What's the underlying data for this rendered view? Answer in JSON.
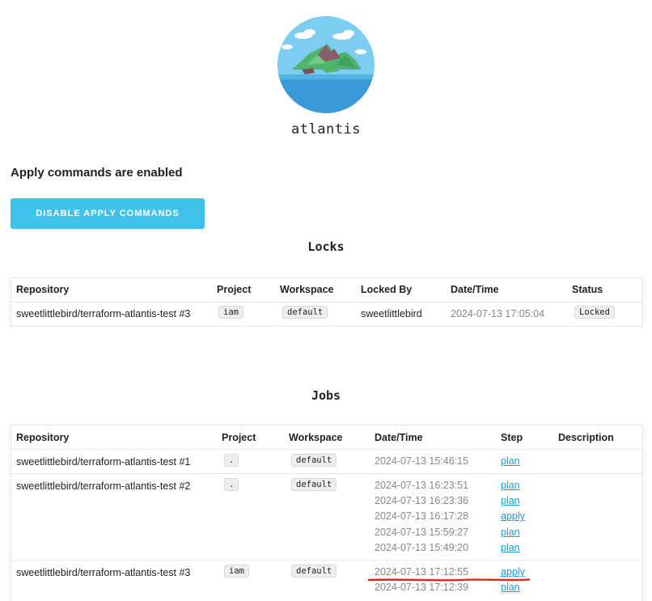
{
  "brand": {
    "name": "atlantis"
  },
  "apply": {
    "status": "Apply commands are enabled",
    "button": "DISABLE APPLY COMMANDS"
  },
  "locks": {
    "title": "Locks",
    "headers": [
      "Repository",
      "Project",
      "Workspace",
      "Locked By",
      "Date/Time",
      "Status"
    ],
    "rows": [
      {
        "repository": "sweetlittlebird/terraform-atlantis-test #3",
        "project": "iam",
        "workspace": "default",
        "locked_by": "sweetlittlebird",
        "datetime": "2024-07-13 17:05:04",
        "status": "Locked"
      }
    ]
  },
  "jobs": {
    "title": "Jobs",
    "headers": [
      "Repository",
      "Project",
      "Workspace",
      "Date/Time",
      "Step",
      "Description"
    ],
    "rows": [
      {
        "repository": "sweetlittlebird/terraform-atlantis-test #1",
        "project": ".",
        "workspace": "default",
        "entries": [
          {
            "datetime": "2024-07-13 15:46:15",
            "step": "plan"
          }
        ]
      },
      {
        "repository": "sweetlittlebird/terraform-atlantis-test #2",
        "project": ".",
        "workspace": "default",
        "entries": [
          {
            "datetime": "2024-07-13 16:23:51",
            "step": "plan"
          },
          {
            "datetime": "2024-07-13 16:23:36",
            "step": "plan"
          },
          {
            "datetime": "2024-07-13 16:17:28",
            "step": "apply"
          },
          {
            "datetime": "2024-07-13 15:59:27",
            "step": "plan"
          },
          {
            "datetime": "2024-07-13 15:49:20",
            "step": "plan"
          }
        ]
      },
      {
        "repository": "sweetlittlebird/terraform-atlantis-test #3",
        "project": "iam",
        "workspace": "default",
        "entries": [
          {
            "datetime": "2024-07-13 17:12:55",
            "step": "apply"
          },
          {
            "datetime": "2024-07-13 17:12:39",
            "step": "plan"
          }
        ]
      }
    ]
  },
  "colors": {
    "accent": "#3fc3ea",
    "link": "#1a9bd7",
    "annotation": "#e8201a"
  }
}
